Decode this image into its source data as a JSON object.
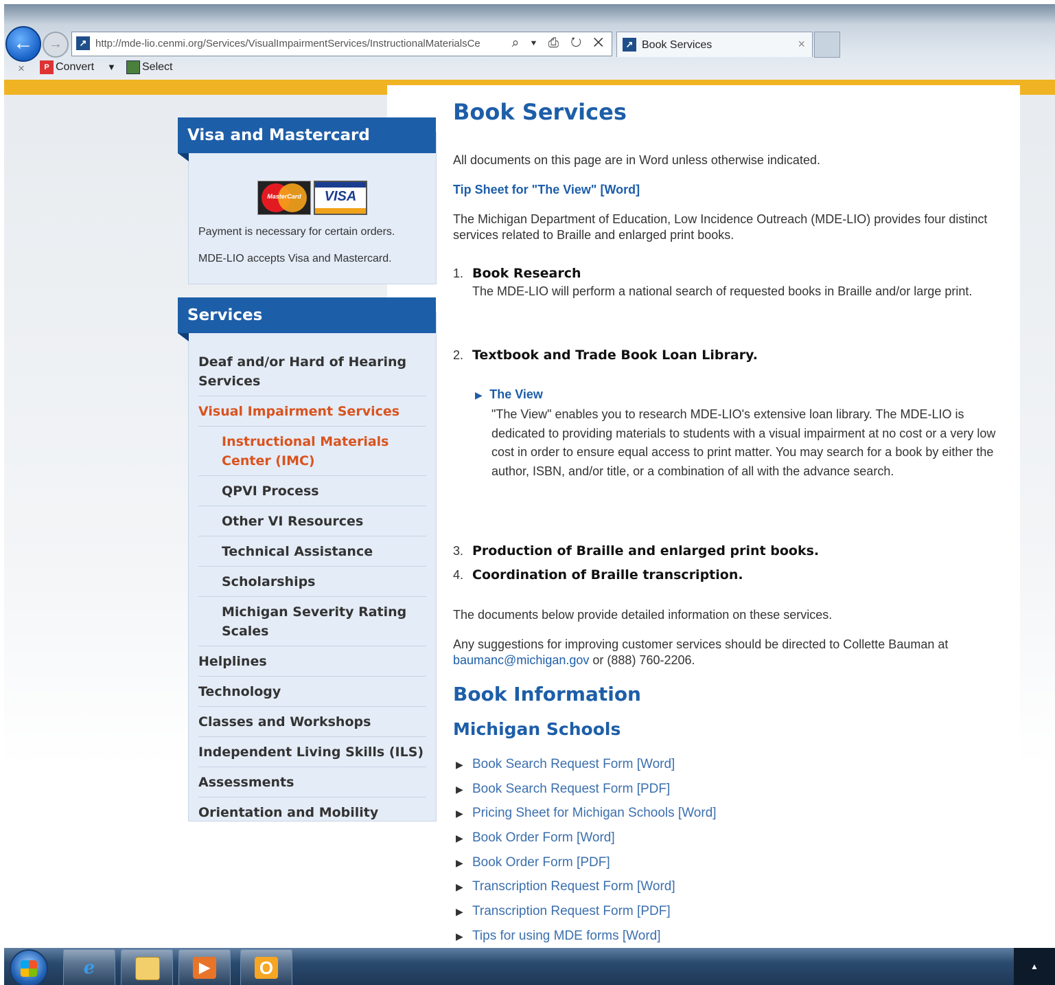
{
  "browser": {
    "url": "http://mde-lio.cenmi.org/Services/VisualImpairmentServices/InstructionalMaterialsCe",
    "address_controls": "⌕ ▾ ⎙ ↻ ✕",
    "tab_title": "Book Services",
    "tab_close": "×",
    "cmd_close": "×",
    "convert_label": "Convert",
    "select_label": "Select"
  },
  "sidebar": {
    "visa_box": {
      "title": "Visa and Mastercard",
      "mastercard_text": "MasterCard",
      "visa_text": "VISA",
      "line1": "Payment is necessary for certain orders.",
      "line2": "MDE-LIO accepts Visa and Mastercard."
    },
    "services_box": {
      "title": "Services",
      "items": [
        {
          "label": "Deaf and/or Hard of Hearing Services"
        },
        {
          "label": "Visual Impairment Services"
        },
        {
          "label": "Instructional Materials Center (IMC)"
        },
        {
          "label": "QPVI Process"
        },
        {
          "label": "Other VI Resources"
        },
        {
          "label": "Technical Assistance"
        },
        {
          "label": "Scholarships"
        },
        {
          "label": "Michigan Severity Rating Scales"
        },
        {
          "label": "Helplines"
        },
        {
          "label": "Technology"
        },
        {
          "label": "Classes and Workshops"
        },
        {
          "label": "Independent Living Skills (ILS)"
        },
        {
          "label": "Assessments"
        },
        {
          "label": "Orientation and Mobility"
        }
      ]
    }
  },
  "main": {
    "title": "Book Services",
    "intro": "All documents on this page are in Word unless otherwise indicated.",
    "tip_link": "Tip Sheet for \"The View\" [Word]",
    "description": "The Michigan Department of Education, Low Incidence Outreach (MDE-LIO) provides four distinct services related to Braille and enlarged print books.",
    "services": [
      {
        "num": "1.",
        "title": "Book Research",
        "text": "The MDE-LIO will perform a national search of requested books in Braille and/or large print."
      },
      {
        "num": "2.",
        "title": "Textbook and Trade Book Loan Library."
      },
      {
        "num": "3.",
        "title": "Production of Braille and enlarged print books."
      },
      {
        "num": "4.",
        "title": "Coordination of Braille transcription."
      }
    ],
    "the_view": {
      "arrow": "▶",
      "link": "The View",
      "text": "\"The View\" enables you to research MDE-LIO's extensive loan library. The MDE-LIO is dedicated to providing materials to students with a visual impairment at no cost or a very low cost in order to ensure equal access to print matter. You may search for a book by either the author, ISBN, and/or title, or a combination of all with the advance search."
    },
    "documents_text": "The documents below provide detailed information on these services.",
    "suggestions_text": "Any suggestions for improving customer services should be directed to Collette Bauman at",
    "suggestions_email": "baumanc@michigan.gov",
    "suggestions_phone": "or (888) 760-2206.",
    "book_info_title": "Book Information",
    "michigan_schools_title": "Michigan Schools",
    "doc_arrow": "▶",
    "doc_links": [
      "Book Search Request Form [Word]",
      "Book Search Request Form [PDF]",
      "Pricing Sheet for Michigan Schools [Word]",
      "Book Order Form [Word]",
      "Book Order Form [PDF]",
      "Transcription Request Form [Word]",
      "Transcription Request Form [PDF]",
      "Tips for using MDE forms [Word]"
    ]
  },
  "taskbar": {
    "ie_label": "e",
    "outlook_label": "O",
    "tray_label": "▲"
  }
}
